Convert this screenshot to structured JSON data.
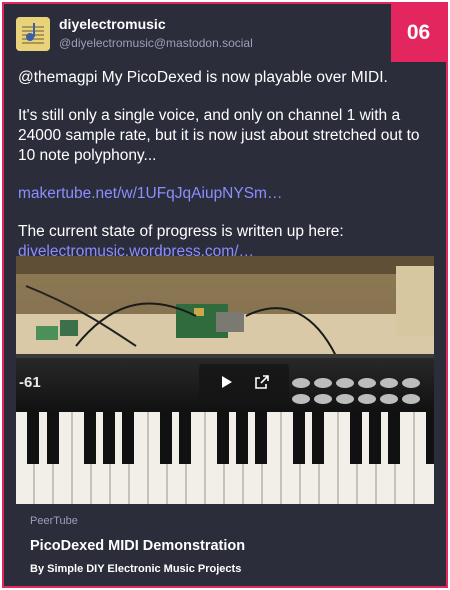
{
  "badge": "06",
  "account": {
    "display_name": "diyelectromusic",
    "handle": "@diyelectromusic@mastodon.social"
  },
  "post": {
    "paragraph1": "@themagpi My PicoDexed is now playable over MIDI.",
    "paragraph2": "It's still only a single voice, and only on channel 1 with a 24000 sample rate, but it is now just about stretched out to 10 note polyphony...",
    "link1": "makertube.net/w/1UFqJqAiupNYSm…",
    "paragraph3": "The current state of progress is written up here:",
    "link2": "diyelectromusic.wordpress.com/…"
  },
  "embed": {
    "provider": "PeerTube",
    "title": "PicoDexed MIDI Demonstration",
    "byline": "By Simple DIY Electronic Music Projects",
    "keyboard_label": "-61",
    "icons": [
      "play-icon",
      "external-link-icon"
    ]
  },
  "colors": {
    "accent": "#e4265e",
    "card_bg": "#2b2d3b",
    "link": "#8c8dff"
  }
}
